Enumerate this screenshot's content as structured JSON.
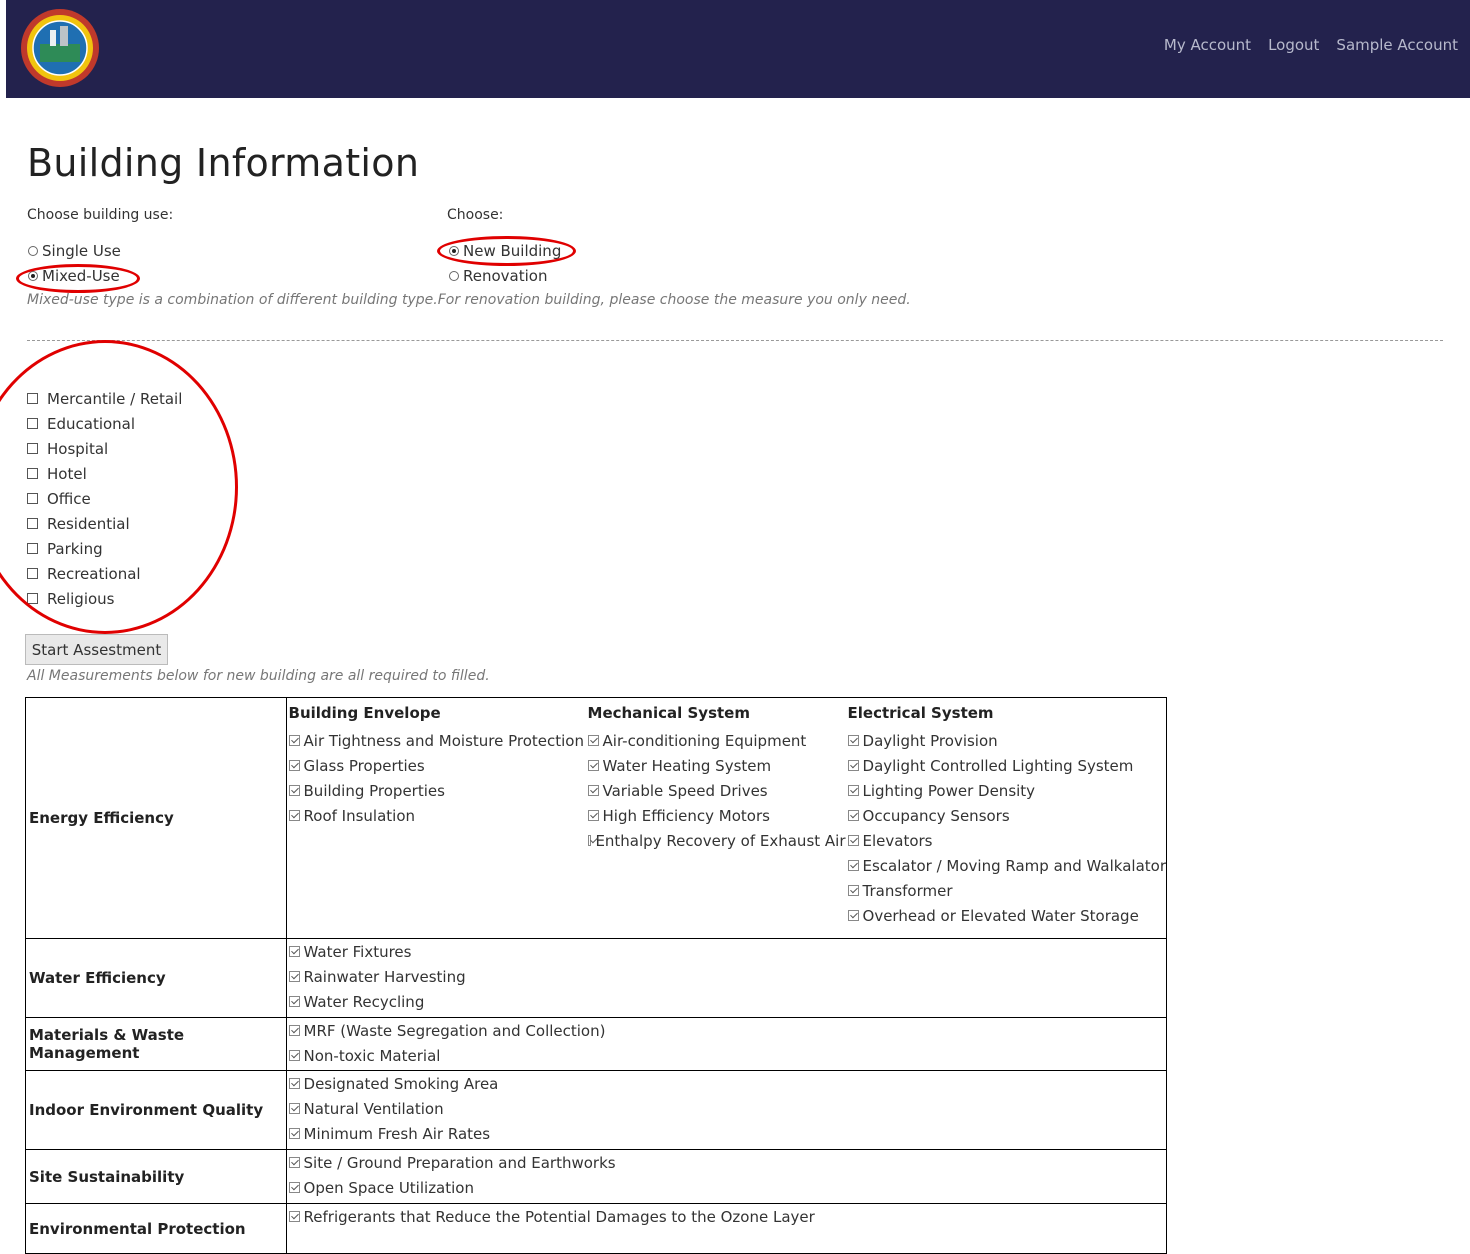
{
  "header": {
    "logo_label": "CITY OF MANDALUYONG",
    "nav": [
      "My Account",
      "Logout",
      "Sample Account"
    ]
  },
  "page": {
    "title": "Building Information",
    "use_label": "Choose building use:",
    "choose_label": "Choose:",
    "use_options": [
      {
        "label": "Single Use",
        "selected": false
      },
      {
        "label": "Mixed-Use",
        "selected": true
      }
    ],
    "build_options": [
      {
        "label": "New Building",
        "selected": true
      },
      {
        "label": "Renovation",
        "selected": false
      }
    ],
    "hint_mixed": "Mixed-use type is a combination of different building type.",
    "hint_renovation": "For renovation building, please choose the measure you only need.",
    "building_types": [
      "Mercantile / Retail",
      "Educational",
      "Hospital",
      "Hotel",
      "Office",
      "Residential",
      "Parking",
      "Recreational",
      "Religious"
    ],
    "start_button": "Start Assestment",
    "measure_note": "All Measurements below for new building are all required to filled."
  },
  "measures": {
    "energy": {
      "label": "Energy Efficiency",
      "envelope_title": "Building Envelope",
      "envelope": [
        "Air Tightness and Moisture Protection",
        "Glass Properties",
        "Building Properties",
        "Roof Insulation"
      ],
      "mechanical_title": "Mechanical System",
      "mechanical": [
        "Air-conditioning Equipment",
        "Water Heating System",
        "Variable Speed Drives",
        "High Efficiency Motors",
        "Enthalpy Recovery of Exhaust Air"
      ],
      "electrical_title": "Electrical System",
      "electrical": [
        "Daylight Provision",
        "Daylight Controlled Lighting System",
        "Lighting Power Density",
        "Occupancy Sensors",
        "Elevators",
        "Escalator / Moving Ramp and Walkalator",
        "Transformer",
        "Overhead or Elevated Water Storage"
      ]
    },
    "water": {
      "label": "Water Efficiency",
      "items": [
        "Water Fixtures",
        "Rainwater Harvesting",
        "Water Recycling"
      ]
    },
    "materials": {
      "label": "Materials & Waste Management",
      "items": [
        "MRF (Waste Segregation and Collection)",
        "Non-toxic Material"
      ]
    },
    "indoor": {
      "label": "Indoor Environment Quality",
      "items": [
        "Designated Smoking Area",
        "Natural Ventilation",
        "Minimum Fresh Air Rates"
      ]
    },
    "site": {
      "label": "Site Sustainability",
      "items": [
        "Site / Ground Preparation and Earthworks",
        "Open Space Utilization"
      ]
    },
    "environment": {
      "label": "Environmental Protection",
      "items": [
        "Refrigerants that Reduce the Potential Damages to the Ozone Layer"
      ]
    }
  },
  "colors": {
    "header_bg": "#23224d",
    "annotation_red": "#e00000"
  }
}
